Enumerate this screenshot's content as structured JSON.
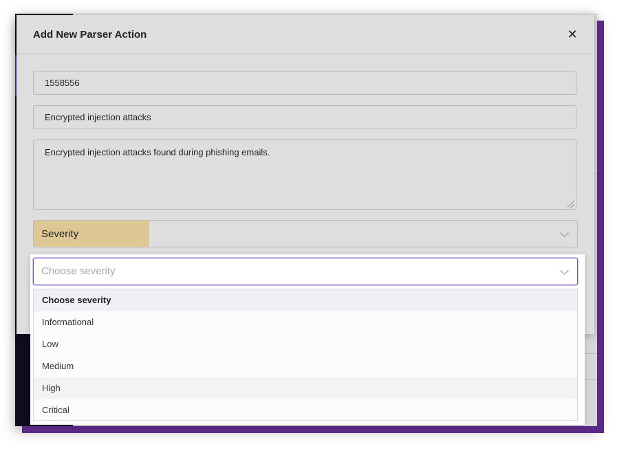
{
  "modal": {
    "title": "Add New Parser Action",
    "close_icon": "close-icon",
    "id_value": "1558556",
    "title_value": "Encrypted injection attacks",
    "description_value": "Encrypted injection attacks found during phishing emails.",
    "severity_label": "Severity"
  },
  "severity_select": {
    "placeholder": "Choose severity",
    "options": [
      {
        "label": "Choose severity"
      },
      {
        "label": "Informational"
      },
      {
        "label": "Low"
      },
      {
        "label": "Medium"
      },
      {
        "label": "High"
      },
      {
        "label": "Critical"
      }
    ]
  },
  "colors": {
    "accent": "#7b4fc4",
    "label_highlight": "#ddc795",
    "sidebar": "#0f0d1f",
    "shadow_purple": "#5b2a86"
  }
}
